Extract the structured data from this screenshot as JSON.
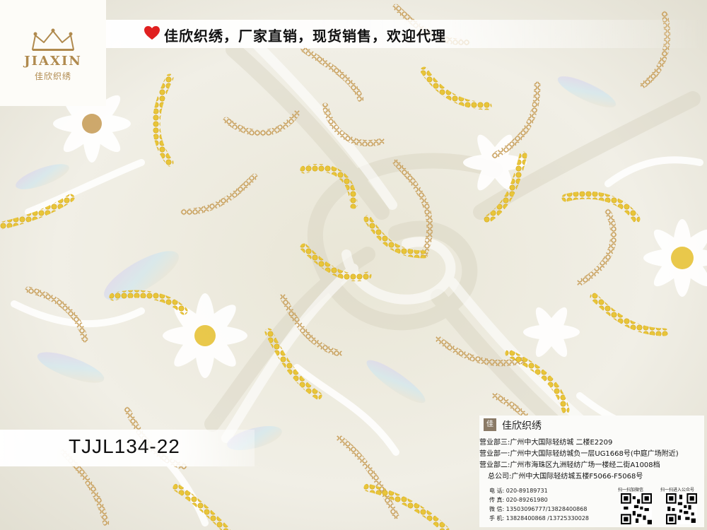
{
  "brand": {
    "logo_en": "JIAXIN",
    "logo_cn": "佳欣织绣"
  },
  "banner": {
    "heart_icon": "heart-icon",
    "text": "佳欣织绣，厂家直销，现货销售，欢迎代理"
  },
  "product": {
    "code": "TJJL134-22"
  },
  "card": {
    "name": "佳欣织绣",
    "addresses": [
      "营业部三:广州中大国际轻纺城 二楼E2209",
      "营业部一:广州中大国际轻纺城负一层UG1668号(中庭广场附近)",
      "营业部二:广州市海珠区九洲轻纺广场一楼经二街A1008档",
      "总公司:广州中大国际轻纺城五楼F5066-F5068号"
    ],
    "contacts": [
      "电 话: 020-89189731",
      "传 真: 020-89261980",
      "微 信: 13503096777/13828400868",
      "手 机: 13828400868 /13725330028"
    ],
    "qr_labels": [
      "扫一扫加微信",
      "扫一扫进入公众号"
    ]
  },
  "colors": {
    "gold_sequin": "#c9a15e",
    "yellow_sequin": "#e8c53a",
    "fabric": "#f3f1e8",
    "heart": "#e02020",
    "logo_gold": "#b08a4e"
  }
}
